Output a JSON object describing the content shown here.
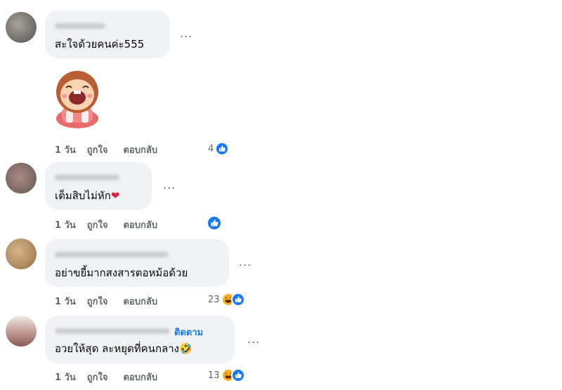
{
  "comments": [
    {
      "text": "สะใจด้วยคนค่ะ555",
      "actions": {
        "time": "1 วัน",
        "like": "ถูกใจ",
        "reply": "ตอบกลับ"
      },
      "reaction_count": "4",
      "reactions": [
        "like"
      ],
      "sticker": "laughing-girl-sticker"
    },
    {
      "text": "เต็มสิบไม่หัก",
      "emoji": "❤",
      "actions": {
        "time": "1 วัน",
        "like": "ถูกใจ",
        "reply": "ตอบกลับ"
      },
      "reaction_count": "",
      "reactions": [
        "like"
      ]
    },
    {
      "text": "อย่าขยี้มากสงสารตอหม้อด้วย",
      "actions": {
        "time": "1 วัน",
        "like": "ถูกใจ",
        "reply": "ตอบกลับ"
      },
      "reaction_count": "23",
      "reactions": [
        "haha",
        "like"
      ]
    },
    {
      "follow_label": "ติดตาม",
      "text": "อวยให้สุด ละหยุดที่คนกลาง",
      "emoji": "🤣",
      "actions": {
        "time": "1 วัน",
        "like": "ถูกใจ",
        "reply": "ตอบกลับ"
      },
      "reaction_count": "13",
      "reactions": [
        "haha",
        "like"
      ]
    }
  ],
  "more_options_label": "...",
  "colors": {
    "bubble": "#f0f2f5",
    "like_blue": "#1877f2",
    "haha_yellow": "#f7b125",
    "meta_text": "#65676b"
  }
}
